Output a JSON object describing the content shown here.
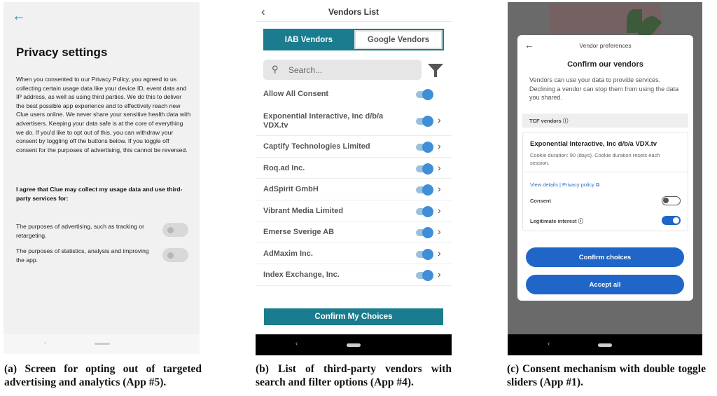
{
  "screen_a": {
    "back_icon": "←",
    "title": "Privacy settings",
    "body": "When you consented to our Privacy Policy, you agreed to us collecting certain usage data like your device ID, event data and IP address, as well as using third parties. We do this to deliver the best possible app experience and to effectively reach new Clue users online. We never share your sensitive health data with advertisers. Keeping your data safe is at the core of everything we do. If you'd like to opt out of this, you can withdraw your consent by toggling off the buttons below. If you toggle off consent for the purposes of advertising, this cannot be reversed.",
    "agree": "I agree that Clue may collect my usage data and use third-party services for:",
    "options": [
      {
        "label": "The purposes of advertising, such as tracking or retargeting.",
        "enabled": false
      },
      {
        "label": "The purposes of statistics, analysis and improving the app.",
        "enabled": false
      }
    ],
    "nav_back": "‹"
  },
  "screen_b": {
    "back_icon": "‹",
    "title": "Vendors List",
    "tabs": [
      "IAB Vendors",
      "Google Vendors"
    ],
    "search_icon": "⚲",
    "search_placeholder": "Search...",
    "allow_all": "Allow All Consent",
    "vendors": [
      "Exponential Interactive, Inc d/b/a VDX.tv",
      "Captify Technologies Limited",
      "Roq.ad Inc.",
      "AdSpirit GmbH",
      "Vibrant Media Limited",
      "Emerse Sverige AB",
      "AdMaxim Inc.",
      "Index Exchange, Inc."
    ],
    "chevron": "›",
    "confirm": "Confirm My Choices",
    "nav_back": "‹"
  },
  "screen_c": {
    "back_icon": "←",
    "header": "Vendor preferences",
    "title": "Confirm our vendors",
    "description": "Vendors can use your data to provide services. Declining a vendor can stop them from using the data you shared.",
    "tcf_label": "TCF vendors ⓘ",
    "vendor_name": "Exponential Interactive, Inc d/b/a VDX.tv",
    "cookie_text": "Cookie duration: 90 (days). Cookie duration resets each session.",
    "view_details": "View details",
    "link_sep": " | ",
    "privacy_policy": "Privacy policy ⧉",
    "consent_label": "Consent",
    "consent_on": false,
    "legit_label": "Legitimate interest ⓘ",
    "legit_on": true,
    "confirm_btn": "Confirm choices",
    "accept_btn": "Accept all",
    "nav_back": "‹"
  },
  "captions": {
    "a": "(a) Screen for opting out of targeted advertising and analytics (App #5).",
    "b": "(b) List of third-party vendors with search and filter options (App #4).",
    "c": "(c) Consent mechanism with double toggle sliders (App #1)."
  }
}
